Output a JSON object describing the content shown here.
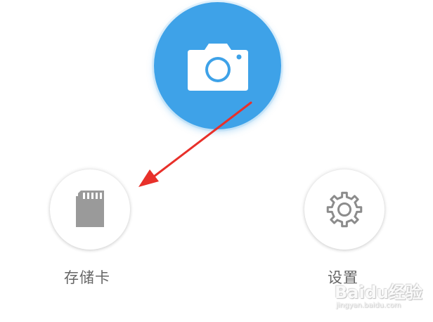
{
  "camera": {
    "icon": "camera-icon",
    "color": "#3ea2e8"
  },
  "storage": {
    "icon": "sd-card-icon",
    "label": "存储卡"
  },
  "settings": {
    "icon": "gear-icon",
    "label": "设置"
  },
  "annotation": {
    "type": "arrow",
    "color": "#e8302a",
    "from": "camera-button",
    "to": "storage-button"
  },
  "watermark": {
    "text": "Baidu经验",
    "url": "jingyan.baidu.com"
  }
}
